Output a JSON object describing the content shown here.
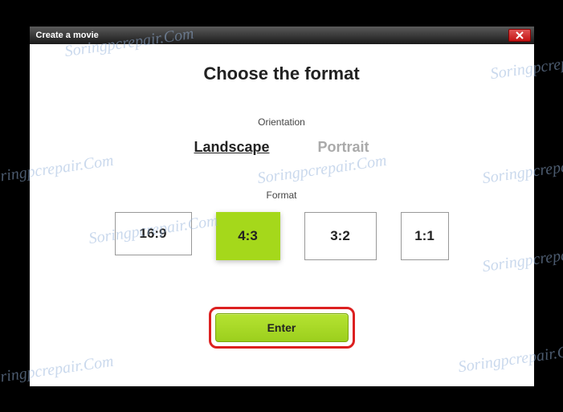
{
  "window": {
    "title": "Create a movie"
  },
  "heading": "Choose the format",
  "orientation": {
    "label": "Orientation",
    "options": [
      "Landscape",
      "Portrait"
    ],
    "selected": "Landscape"
  },
  "format": {
    "label": "Format",
    "options": [
      "16:9",
      "4:3",
      "3:2",
      "1:1"
    ],
    "selected": "4:3"
  },
  "enter_label": "Enter",
  "watermark_text": "Soringpcrepair.Com"
}
